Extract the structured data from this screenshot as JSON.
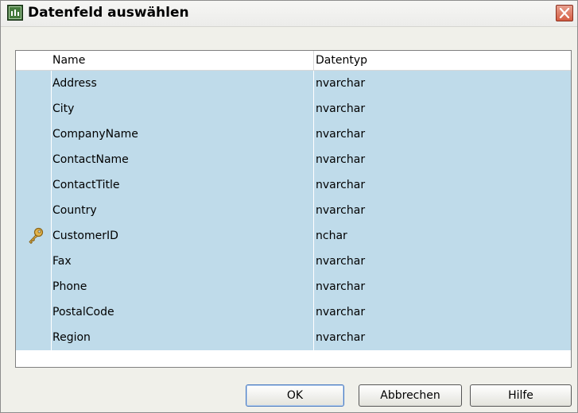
{
  "window": {
    "title": "Datenfeld auswählen"
  },
  "table": {
    "headers": {
      "name": "Name",
      "type": "Datentyp"
    },
    "rows": [
      {
        "name": "Address",
        "type": "nvarchar",
        "key": false
      },
      {
        "name": "City",
        "type": "nvarchar",
        "key": false
      },
      {
        "name": "CompanyName",
        "type": "nvarchar",
        "key": false
      },
      {
        "name": "ContactName",
        "type": "nvarchar",
        "key": false
      },
      {
        "name": "ContactTitle",
        "type": "nvarchar",
        "key": false
      },
      {
        "name": "Country",
        "type": "nvarchar",
        "key": false
      },
      {
        "name": "CustomerID",
        "type": "nchar",
        "key": true
      },
      {
        "name": "Fax",
        "type": "nvarchar",
        "key": false
      },
      {
        "name": "Phone",
        "type": "nvarchar",
        "key": false
      },
      {
        "name": "PostalCode",
        "type": "nvarchar",
        "key": false
      },
      {
        "name": "Region",
        "type": "nvarchar",
        "key": false
      }
    ]
  },
  "buttons": {
    "ok": "OK",
    "cancel": "Abbrechen",
    "help": "Hilfe"
  },
  "colors": {
    "row_highlight": "#bfdbea",
    "dialog_background": "#f0f0ea",
    "close_button": "#d55d43"
  },
  "icons": {
    "app": "app-window-icon",
    "close": "close-icon",
    "primary_key": "key-icon"
  }
}
